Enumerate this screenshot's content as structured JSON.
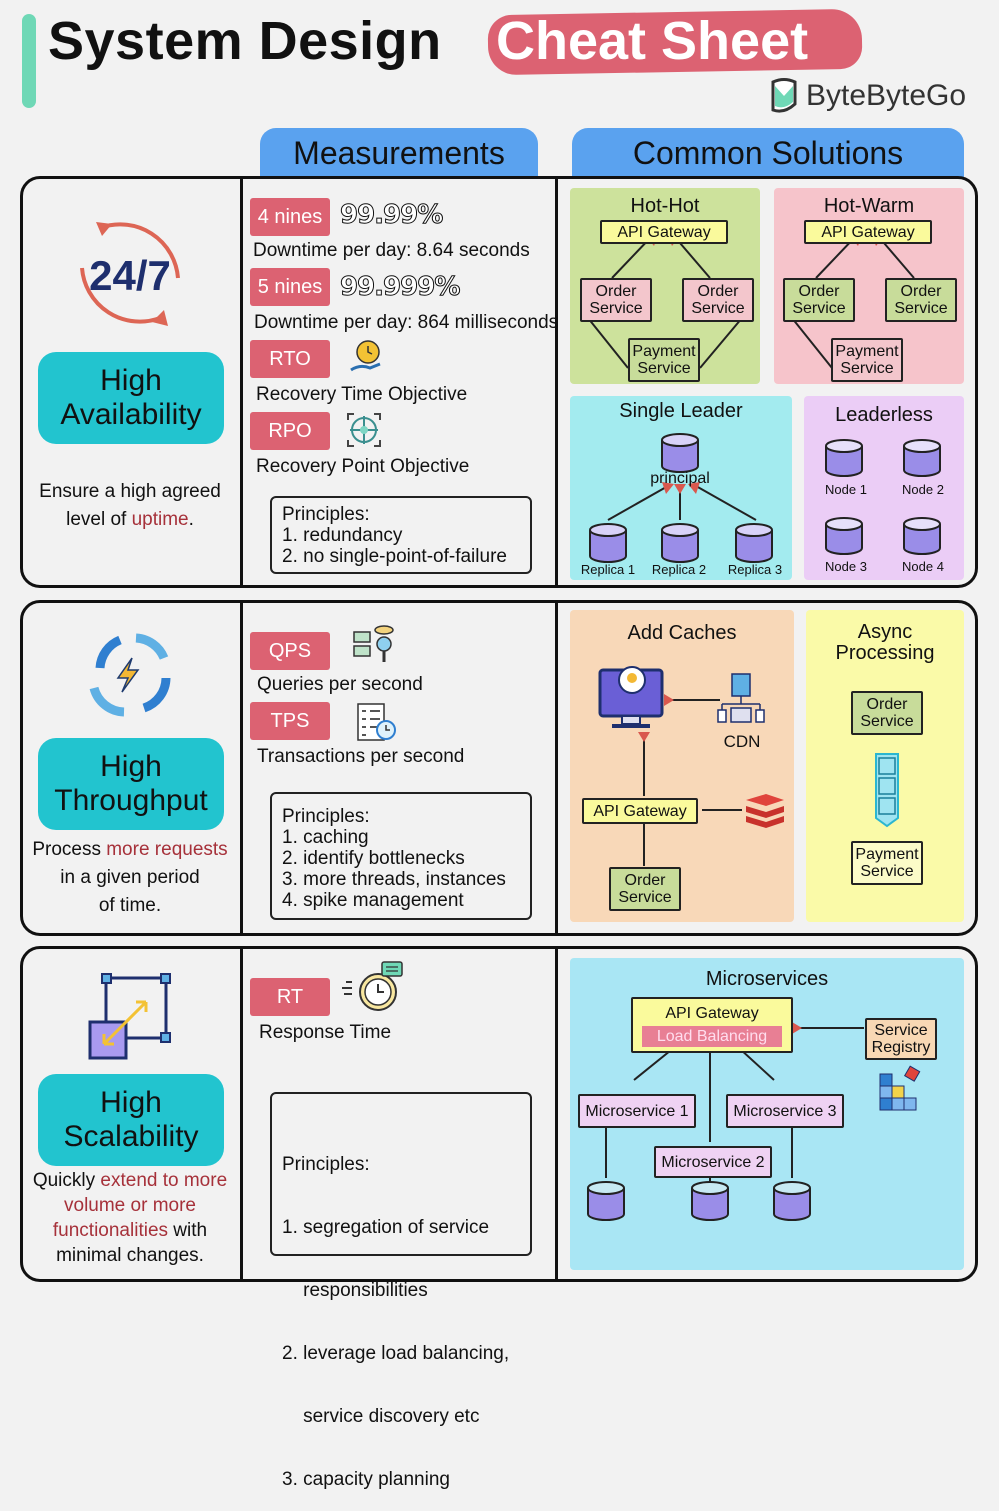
{
  "header": {
    "title_main": "System Design",
    "title_highlight": "Cheat Sheet",
    "brand": "ByteByteGo",
    "accent_color": "#dc6272",
    "bar_color": "#6fd8b6"
  },
  "columns": {
    "measurements": "Measurements",
    "solutions": "Common Solutions"
  },
  "availability": {
    "title_line1": "High",
    "title_line2": "Availability",
    "icon_text": "24/7",
    "desc_a": "Ensure a high agreed",
    "desc_b": "level of ",
    "desc_hl": "uptime",
    "desc_end": ".",
    "measures": [
      {
        "badge": "4 nines",
        "value": "99.99%",
        "text": "Downtime per day: 8.64 seconds"
      },
      {
        "badge": "5 nines",
        "value": "99.999%",
        "text": "Downtime per day: 864 milliseconds"
      },
      {
        "badge": "RTO",
        "text": "Recovery Time Objective"
      },
      {
        "badge": "RPO",
        "text": "Recovery Point Objective"
      }
    ],
    "principles": [
      "Principles:",
      "1. redundancy",
      "2. no single-point-of-failure"
    ],
    "solutions": {
      "hothot": {
        "title": "Hot-Hot",
        "gateway": "API Gateway",
        "order": "Order Service",
        "payment": "Payment Service"
      },
      "hotwarm": {
        "title": "Hot-Warm",
        "gateway": "API Gateway",
        "order": "Order Service",
        "payment": "Payment Service"
      },
      "single": {
        "title": "Single Leader",
        "principal": "principal",
        "replicas": [
          "Replica 1",
          "Replica 2",
          "Replica 3"
        ]
      },
      "leaderless": {
        "title": "Leaderless",
        "nodes": [
          "Node 1",
          "Node 2",
          "Node 3",
          "Node 4"
        ]
      }
    }
  },
  "throughput": {
    "title_line1": "High",
    "title_line2": "Throughput",
    "desc_a": "Process ",
    "desc_hl": "more requests",
    "desc_b": "in a given period",
    "desc_c": "of time.",
    "measures": [
      {
        "badge": "QPS",
        "text": "Queries per second"
      },
      {
        "badge": "TPS",
        "text": "Transactions per second"
      }
    ],
    "principles": [
      "Principles:",
      "1. caching",
      "2. identify bottlenecks",
      "3. more threads, instances",
      "4. spike management"
    ],
    "solutions": {
      "caches": {
        "title": "Add Caches",
        "cdn": "CDN",
        "gateway": "API Gateway",
        "order": "Order Service"
      },
      "async": {
        "title_line1": "Async",
        "title_line2": "Processing",
        "order": "Order Service",
        "payment": "Payment Service"
      }
    }
  },
  "scalability": {
    "title_line1": "High",
    "title_line2": "Scalability",
    "desc_a": "Quickly ",
    "desc_hl1": "extend to more",
    "desc_hl2": "volume or more",
    "desc_hl3": "functionalities",
    "desc_b": " with",
    "desc_c": "minimal changes.",
    "measures": [
      {
        "badge": "RT",
        "text": "Response Time"
      }
    ],
    "principles": [
      "Principles:",
      "1. segregation of service",
      "    responsibilities",
      "2. leverage load balancing,",
      "    service discovery etc",
      "3. capacity planning"
    ],
    "solutions": {
      "micro": {
        "title": "Microservices",
        "gateway": "API Gateway",
        "lb": "Load Balancing",
        "registry": "Service Registry",
        "services": [
          "Microservice 1",
          "Microservice 2",
          "Microservice 3"
        ]
      }
    }
  }
}
